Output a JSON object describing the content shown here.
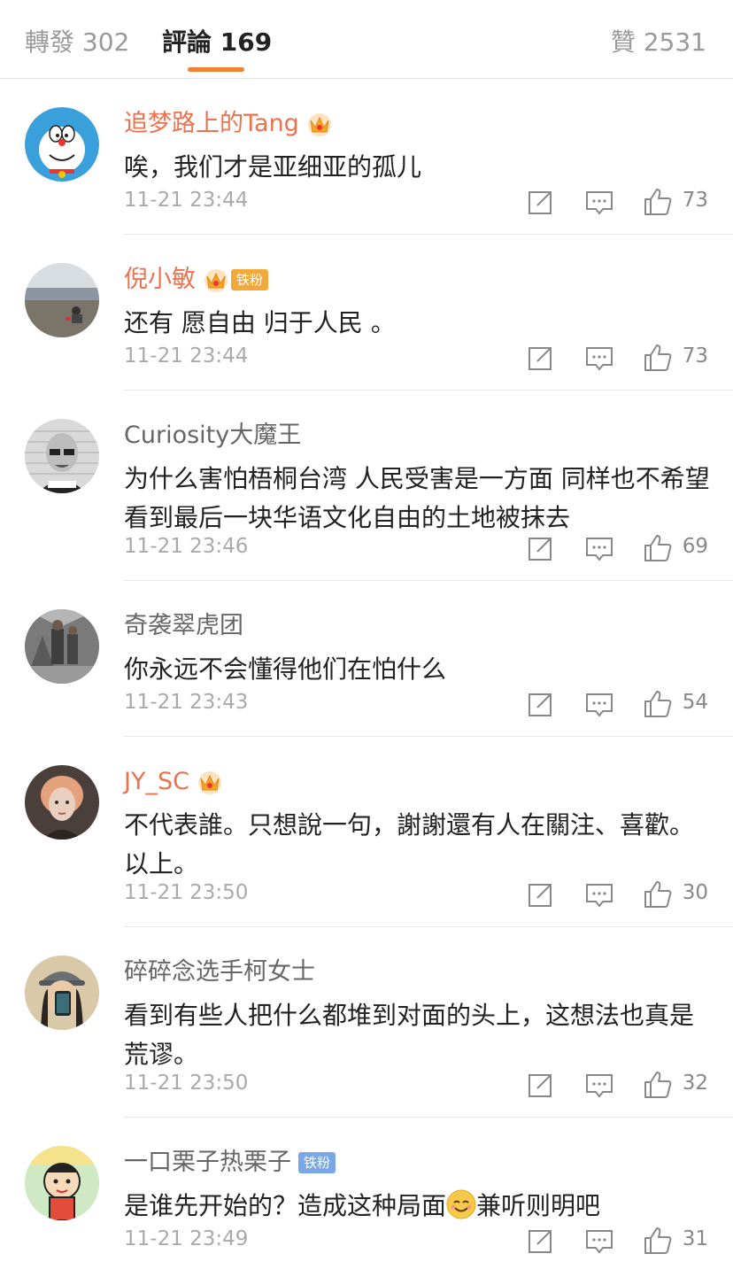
{
  "tabs": {
    "repost": "轉發 302",
    "comments": "評論 169",
    "likes": "贊 2531",
    "active_color": "#f08133"
  },
  "colors": {
    "vip_name": "#eb7350",
    "plain_name": "#666666",
    "meta": "#aaaaaa"
  },
  "comments": [
    {
      "author": "追梦路上的Tang",
      "vip": true,
      "badge": "",
      "text": "唉，我们才是亚细亚的孤儿",
      "time": "11-21 23:44",
      "likes": "73",
      "avatar": "doraemon-avatar"
    },
    {
      "author": "倪小敏",
      "vip": true,
      "badge": "铁粉",
      "text": "还有 愿自由 归于人民 。",
      "time": "11-21 23:44",
      "likes": "73",
      "avatar": "beach-photo-avatar"
    },
    {
      "author": "Curiosity大魔王",
      "vip": false,
      "badge": "",
      "text": "为什么害怕梧桐台湾 人民受害是一方面 同样也不希望看到最后一块华语文化自由的土地被抹去",
      "time": "11-21 23:46",
      "likes": "69",
      "avatar": "mugshot-avatar"
    },
    {
      "author": "奇袭翠虎团",
      "vip": false,
      "badge": "",
      "text": "你永远不会懂得他们在怕什么",
      "time": "11-21 23:43",
      "likes": "54",
      "avatar": "group-photo-avatar"
    },
    {
      "author": "JY_SC",
      "vip": true,
      "badge": "",
      "text": "不代表誰。只想說一句，謝謝還有人在關注、喜歡。以上。",
      "time": "11-21 23:50",
      "likes": "30",
      "avatar": "girl-portrait-avatar"
    },
    {
      "author": "碎碎念选手柯女士",
      "vip": false,
      "badge": "",
      "text": "看到有些人把什么都堆到对面的头上，这想法也真是荒谬。",
      "time": "11-21 23:50",
      "likes": "32",
      "avatar": "selfie-avatar"
    },
    {
      "author": "一口栗子热栗子",
      "vip": false,
      "badge": "铁粉",
      "text": "是谁先开始的？造成这种局面",
      "text_after_emoji": "兼听则明吧",
      "time": "11-21 23:49",
      "likes": "31",
      "avatar": "cartoon-avatar"
    }
  ]
}
